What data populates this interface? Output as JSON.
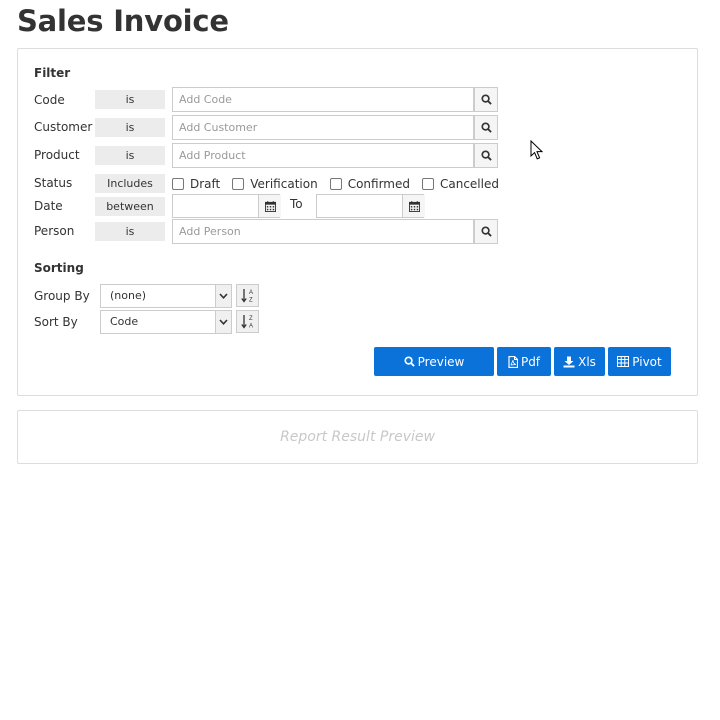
{
  "page": {
    "title": "Sales Invoice"
  },
  "filter": {
    "title": "Filter",
    "code": {
      "label": "Code",
      "operator": "is",
      "placeholder": "Add Code"
    },
    "customer": {
      "label": "Customer",
      "operator": "is",
      "placeholder": "Add Customer"
    },
    "product": {
      "label": "Product",
      "operator": "is",
      "placeholder": "Add Product"
    },
    "status": {
      "label": "Status",
      "operator": "Includes",
      "options": [
        {
          "label": "Draft",
          "checked": false
        },
        {
          "label": "Verification",
          "checked": false
        },
        {
          "label": "Confirmed",
          "checked": false
        },
        {
          "label": "Cancelled",
          "checked": false
        }
      ]
    },
    "date": {
      "label": "Date",
      "operator": "between",
      "from": "",
      "to_label": "To",
      "to": ""
    },
    "person": {
      "label": "Person",
      "operator": "is",
      "placeholder": "Add Person"
    }
  },
  "sorting": {
    "title": "Sorting",
    "group_by": {
      "label": "Group By",
      "value": "(none)"
    },
    "sort_by": {
      "label": "Sort By",
      "value": "Code"
    }
  },
  "actions": {
    "preview": "Preview",
    "pdf": "Pdf",
    "xls": "Xls",
    "pivot": "Pivot"
  },
  "result": {
    "placeholder": "Report Result Preview"
  },
  "colors": {
    "primary": "#0a72d8",
    "border": "#dddddd",
    "operator_bg": "#ececec"
  },
  "icons": {
    "search": "search-icon",
    "calendar": "calendar-icon",
    "dropdown": "chevron-down-icon",
    "sort_asc": "sort-alpha-asc-icon",
    "sort_desc": "sort-alpha-desc-icon",
    "pdf": "file-pdf-icon",
    "xls": "download-icon",
    "pivot": "table-icon",
    "cursor": "mouse-pointer-icon"
  }
}
